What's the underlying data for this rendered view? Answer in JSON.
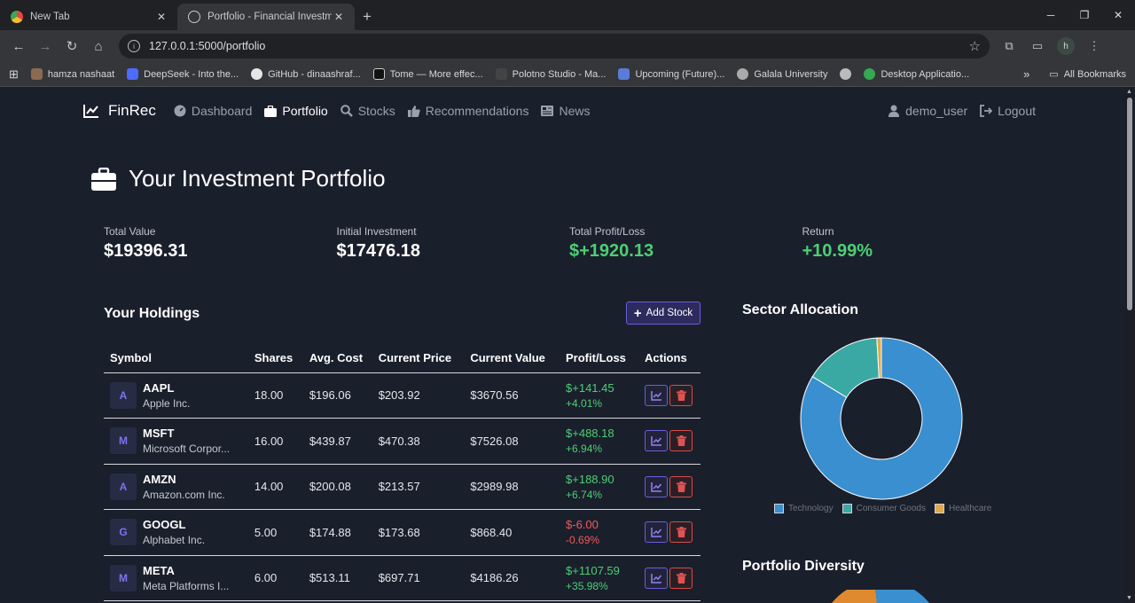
{
  "browser": {
    "tabs": [
      {
        "title": "New Tab",
        "active": false
      },
      {
        "title": "Portfolio - Financial Investment",
        "active": true
      }
    ],
    "url": "127.0.0.1:5000/portfolio",
    "profile_initial": "h",
    "bookmarks": [
      "hamza nashaat",
      "DeepSeek - Into the...",
      "GitHub - dinaashraf...",
      "Tome — More effec...",
      "Polotno Studio - Ma...",
      "Upcoming (Future)...",
      "Galala University",
      "",
      "Desktop Applicatio..."
    ],
    "all_bookmarks": "All Bookmarks"
  },
  "nav": {
    "brand": "FinRec",
    "items": [
      {
        "label": "Dashboard",
        "icon": "dashboard-icon",
        "active": false
      },
      {
        "label": "Portfolio",
        "icon": "briefcase-icon",
        "active": true
      },
      {
        "label": "Stocks",
        "icon": "search-icon",
        "active": false
      },
      {
        "label": "Recommendations",
        "icon": "thumbs-up-icon",
        "active": false
      },
      {
        "label": "News",
        "icon": "newspaper-icon",
        "active": false
      }
    ],
    "user": "demo_user",
    "logout": "Logout"
  },
  "page_title": "Your Investment Portfolio",
  "stats": [
    {
      "label": "Total Value",
      "value": "$19396.31",
      "positive": false
    },
    {
      "label": "Initial Investment",
      "value": "$17476.18",
      "positive": false
    },
    {
      "label": "Total Profit/Loss",
      "value": "$+1920.13",
      "positive": true
    },
    {
      "label": "Return",
      "value": "+10.99%",
      "positive": true
    }
  ],
  "holdings": {
    "title": "Your Holdings",
    "add_button": "Add Stock",
    "columns": [
      "Symbol",
      "Shares",
      "Avg. Cost",
      "Current Price",
      "Current Value",
      "Profit/Loss",
      "Actions"
    ],
    "rows": [
      {
        "letter": "A",
        "symbol": "AAPL",
        "name": "Apple Inc.",
        "shares": "18.00",
        "avg_cost": "$196.06",
        "price": "$203.92",
        "value": "$3670.56",
        "pl": "$+141.45",
        "pl_pct": "+4.01%",
        "positive": true
      },
      {
        "letter": "M",
        "symbol": "MSFT",
        "name": "Microsoft Corpor...",
        "shares": "16.00",
        "avg_cost": "$439.87",
        "price": "$470.38",
        "value": "$7526.08",
        "pl": "$+488.18",
        "pl_pct": "+6.94%",
        "positive": true
      },
      {
        "letter": "A",
        "symbol": "AMZN",
        "name": "Amazon.com Inc.",
        "shares": "14.00",
        "avg_cost": "$200.08",
        "price": "$213.57",
        "value": "$2989.98",
        "pl": "$+188.90",
        "pl_pct": "+6.74%",
        "positive": true
      },
      {
        "letter": "G",
        "symbol": "GOOGL",
        "name": "Alphabet Inc.",
        "shares": "5.00",
        "avg_cost": "$174.88",
        "price": "$173.68",
        "value": "$868.40",
        "pl": "$-6.00",
        "pl_pct": "-0.69%",
        "positive": false
      },
      {
        "letter": "M",
        "symbol": "META",
        "name": "Meta Platforms I...",
        "shares": "6.00",
        "avg_cost": "$513.11",
        "price": "$697.71",
        "value": "$4186.26",
        "pl": "$+1107.59",
        "pl_pct": "+35.98%",
        "positive": true
      }
    ]
  },
  "sector": {
    "title": "Sector Allocation",
    "legend": [
      {
        "label": "Technology",
        "color": "#3a8fd0"
      },
      {
        "label": "Consumer Goods",
        "color": "#3aa9a4"
      },
      {
        "label": "Healthcare",
        "color": "#e0aa4a"
      }
    ],
    "chart_data": {
      "type": "pie",
      "categories": [
        "Technology",
        "Consumer Goods",
        "Healthcare"
      ],
      "values": [
        83.7,
        15.4,
        0.9
      ]
    }
  },
  "diversity": {
    "title": "Portfolio Diversity"
  },
  "colors": {
    "accent": "#6b5fd8",
    "positive": "#4ccf73",
    "negative": "#ef5a5a"
  }
}
